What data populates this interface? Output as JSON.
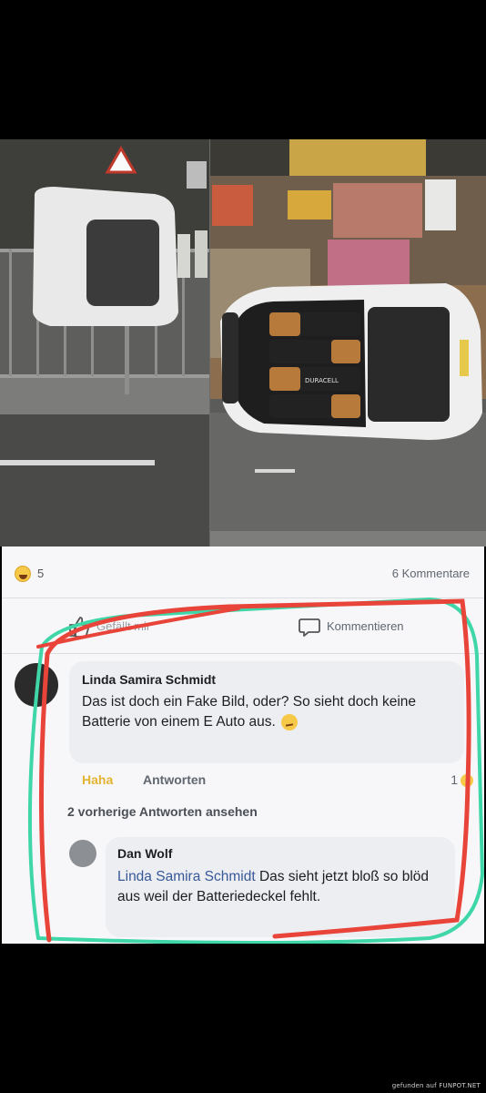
{
  "post": {
    "reaction_count": "5",
    "comment_count": "6 Kommentare",
    "like_label": "Gefällt mir",
    "comment_label": "Kommentieren"
  },
  "comment": {
    "author": "Linda Samira Schmidt",
    "text": "Das ist doch ein Fake Bild, oder? So sieht doch keine Batterie von einem E Auto aus.",
    "haha_label": "Haha",
    "reply_label": "Antworten",
    "reaction_count": "1"
  },
  "previous_replies": "2 vorherige Antworten ansehen",
  "reply": {
    "author": "Dan Wolf",
    "mention": "Linda Samira Schmidt",
    "text": "Das sieht jetzt bloß so blöd aus weil der Batteriedeckel fehlt."
  },
  "photo": {
    "battery_brand": "DURACELL"
  },
  "watermark": "gefunden auf FUNPOT.NET",
  "colors": {
    "background": "#000000",
    "card": "#f7f7f9",
    "mention": "#385898",
    "annotation_red": "#e8443a",
    "annotation_teal": "#3fd6a8"
  }
}
